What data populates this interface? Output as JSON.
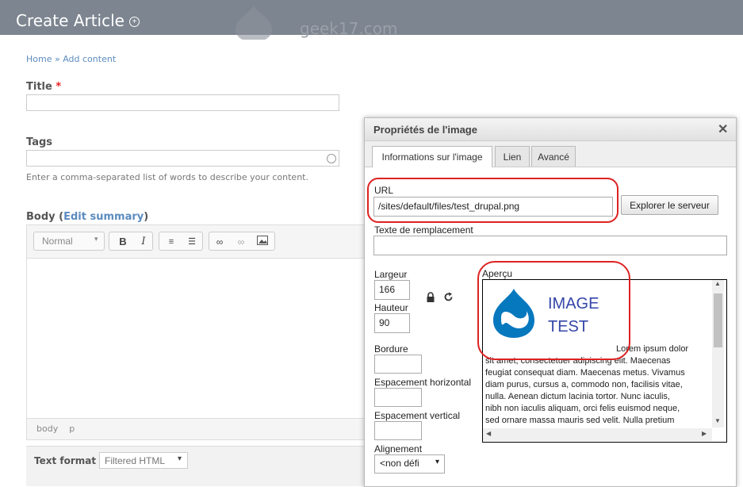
{
  "header": {
    "title": "Create Article",
    "watermark": "geek17.com"
  },
  "breadcrumb": {
    "home": "Home",
    "sep": "»",
    "add": "Add content"
  },
  "title_field": {
    "label": "Title",
    "required": "*",
    "value": ""
  },
  "tags_field": {
    "label": "Tags",
    "value": "",
    "description": "Enter a comma-separated list of words to describe your content."
  },
  "body_field": {
    "label": "Body",
    "edit_summary": "Edit summary",
    "format_select": "Normal",
    "status_path": [
      "body",
      "p"
    ]
  },
  "text_format": {
    "label": "Text format",
    "value": "Filtered HTML"
  },
  "dialog": {
    "title": "Propriétés de l'image",
    "tabs": [
      "Informations sur l'image",
      "Lien",
      "Avancé"
    ],
    "url_label": "URL",
    "url_value": "/sites/default/files/test_drupal.png",
    "browse_button": "Explorer le serveur",
    "alt_label": "Texte de remplacement",
    "alt_value": "",
    "width_label": "Largeur",
    "width_value": "166",
    "height_label": "Hauteur",
    "height_value": "90",
    "border_label": "Bordure",
    "hspace_label": "Espacement horizontal",
    "vspace_label": "Espacement vertical",
    "align_label": "Alignement",
    "align_value": "<non défi",
    "preview_label": "Aperçu",
    "preview_image_text_1": "IMAGE",
    "preview_image_text_2": "TEST",
    "preview_lorem_1": "Lorem ipsum dolor",
    "preview_lorem_2": "sit amet, consectetuer adipiscing elit. Maecenas",
    "preview_lorem_3": "feugiat consequat diam. Maecenas metus. Vivamus",
    "preview_lorem_4": "diam purus, cursus a, commodo non, facilisis vitae,",
    "preview_lorem_5": "nulla. Aenean dictum lacinia tortor. Nunc iaculis,",
    "preview_lorem_6": "nibh non iaculis aliquam, orci felis euismod neque,",
    "preview_lorem_7": "sed ornare massa mauris sed velit. Nulla pretium"
  },
  "colors": {
    "header_bg": "#7d8590",
    "link": "#5b8bbf",
    "annotation": "#dd2222",
    "drupal_blue": "#0678be"
  }
}
